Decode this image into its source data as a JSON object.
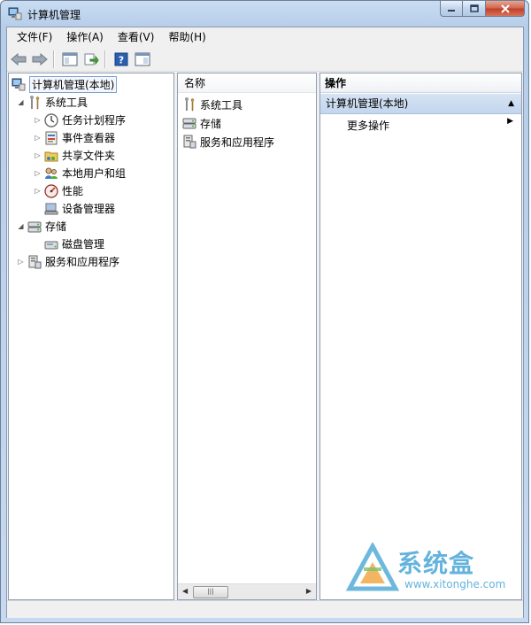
{
  "window": {
    "title": "计算机管理"
  },
  "menu": [
    "文件(F)",
    "操作(A)",
    "查看(V)",
    "帮助(H)"
  ],
  "tree": {
    "root": "计算机管理(本地)",
    "system_tools": "系统工具",
    "task_scheduler": "任务计划程序",
    "event_viewer": "事件查看器",
    "shared_folders": "共享文件夹",
    "local_users": "本地用户和组",
    "performance": "性能",
    "device_manager": "设备管理器",
    "storage": "存储",
    "disk_management": "磁盘管理",
    "services_apps": "服务和应用程序"
  },
  "list": {
    "header": "名称",
    "items": [
      "系统工具",
      "存储",
      "服务和应用程序"
    ],
    "scroll_thumb": "|||"
  },
  "actions": {
    "header": "操作",
    "group": "计算机管理(本地)",
    "more": "更多操作"
  },
  "watermark": {
    "text": "系统盒",
    "url": "www.xitonghe.com"
  },
  "colors": {
    "accent": "#4aa6d6",
    "close": "#c7452e",
    "selection": "#c3d6ee"
  }
}
